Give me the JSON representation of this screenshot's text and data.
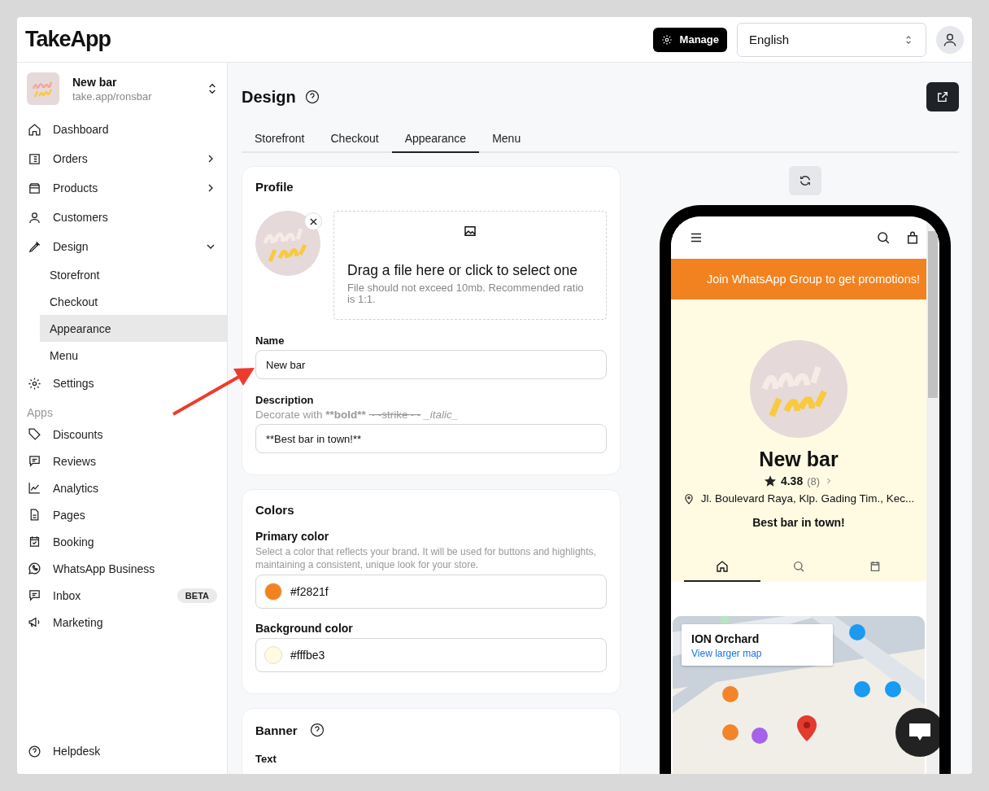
{
  "app": {
    "logo": "TakeApp",
    "manage_button": "Manage",
    "language": "English"
  },
  "store": {
    "name": "New bar",
    "url": "take.app/ronsbar"
  },
  "sidebar": {
    "items": [
      {
        "label": "Dashboard"
      },
      {
        "label": "Orders",
        "expanded": false
      },
      {
        "label": "Products",
        "expanded": false
      },
      {
        "label": "Customers"
      },
      {
        "label": "Design",
        "expanded": true,
        "children": [
          {
            "label": "Storefront",
            "selected": false
          },
          {
            "label": "Checkout",
            "selected": false
          },
          {
            "label": "Appearance",
            "selected": true
          },
          {
            "label": "Menu",
            "selected": false
          }
        ]
      },
      {
        "label": "Settings"
      }
    ],
    "apps_heading": "Apps",
    "apps": [
      {
        "label": "Discounts"
      },
      {
        "label": "Reviews"
      },
      {
        "label": "Analytics"
      },
      {
        "label": "Pages"
      },
      {
        "label": "Booking"
      },
      {
        "label": "WhatsApp Business"
      },
      {
        "label": "Inbox",
        "badge": "BETA"
      },
      {
        "label": "Marketing"
      }
    ],
    "footer_item": "Helpdesk"
  },
  "page": {
    "title": "Design"
  },
  "tabs": [
    {
      "label": "Storefront",
      "selected": false
    },
    {
      "label": "Checkout",
      "selected": false
    },
    {
      "label": "Appearance",
      "selected": true
    },
    {
      "label": "Menu",
      "selected": false
    }
  ],
  "profile": {
    "title": "Profile",
    "upload_title": "Drag a file here or click to select one",
    "upload_hint": "File should not exceed 10mb. Recommended ratio is 1:1.",
    "name_label": "Name",
    "name_value": "New bar",
    "description_label": "Description",
    "description_hint": [
      "Decorate with",
      "**bold**",
      "~~strike~~",
      "_italic_"
    ],
    "description_value": "**Best bar in town!**"
  },
  "colors": {
    "title": "Colors",
    "fields": [
      {
        "label": "Primary color",
        "help": "Select a color that reflects your brand. It will be used for buttons and highlights, maintaining a consistent, unique look for your store.",
        "value": "#f2821f",
        "color": "#f2821f"
      },
      {
        "label": "Background color",
        "value": "#fffbe3",
        "color": "#fffbe3"
      }
    ]
  },
  "banner": {
    "title": "Banner",
    "text_label": "Text"
  },
  "preview": {
    "announcement": "Join WhatsApp Group to get promotions!",
    "store_name": "New bar",
    "rating": "4.38",
    "review_count": "(8)",
    "address": "Jl. Boulevard Raya, Klp. Gading Tim., Kec...",
    "description": "Best bar in town!",
    "tabs": [
      {
        "selected": true
      },
      {
        "selected": false
      },
      {
        "selected": false
      }
    ],
    "map_card": {
      "title": "ION Orchard",
      "link": "View larger map"
    }
  }
}
